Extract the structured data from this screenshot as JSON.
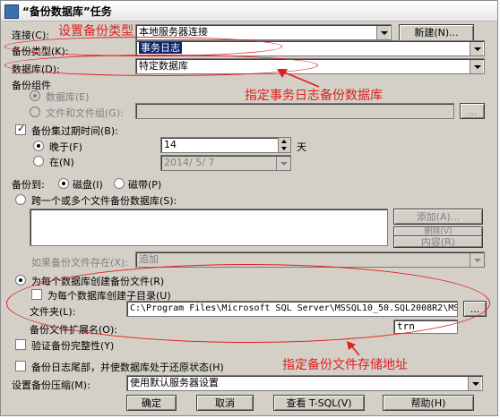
{
  "window": {
    "title": "“备份数据库”任务"
  },
  "connection": {
    "label": "连接(C):",
    "value": "本地服务器连接",
    "new_button": "新建(N)..."
  },
  "backup_type": {
    "label": "备份类型(K):",
    "value": "事务日志"
  },
  "database": {
    "label": "数据库(D):",
    "value": "特定数据库"
  },
  "backup_component": {
    "label": "备份组件",
    "database_option": "数据库(E)",
    "files_option": "文件和文件组(G):",
    "browse_button": "..."
  },
  "expiry": {
    "checkbox_label": "备份集过期时间(B):",
    "after_label": "晚于(F)",
    "after_value": "14",
    "unit": "天",
    "on_label": "在(N)",
    "on_value": "2014/ 5/ 7"
  },
  "backup_to": {
    "label": "备份到:",
    "disk": "磁盘(I)",
    "tape": "磁带(P)"
  },
  "span_files": {
    "label": "跨一个或多个文件备份数据库(S):",
    "add_button": "添加(A)...",
    "remove_button": "删除(V)",
    "contents_button": "内容(R)",
    "if_exists_label": "如果备份文件存在(X):",
    "if_exists_value": "追加"
  },
  "per_db": {
    "label": "为每个数据库创建备份文件(R)",
    "subdir_label": "为每个数据库创建子目录(U)",
    "folder_label": "文件夹(L):",
    "folder_value": "C:\\Program Files\\Microsoft SQL Server\\MSSQL10_50.SQL2008R2\\MSSQL\\",
    "folder_browse": "...",
    "ext_label": "备份文件扩展名(O):",
    "ext_value": "trn"
  },
  "verify": {
    "label": "验证备份完整性(Y)"
  },
  "tail_log": {
    "label": "备份日志尾部，并使数据库处于还原状态(H)"
  },
  "compression": {
    "label": "设置备份压缩(M):",
    "value": "使用默认服务器设置"
  },
  "buttons": {
    "ok": "确定",
    "cancel": "取消",
    "view_tsql": "查看 T-SQL(V)",
    "help": "帮助(H)"
  },
  "annotations": {
    "set_type": "设置备份类型",
    "set_db": "指定事务日志备份数据库",
    "set_path": "指定备份文件存储地址"
  },
  "colors": {
    "annotation": "#e02020",
    "selection": "#0a246a",
    "dialog_bg": "#d4d0c8"
  }
}
